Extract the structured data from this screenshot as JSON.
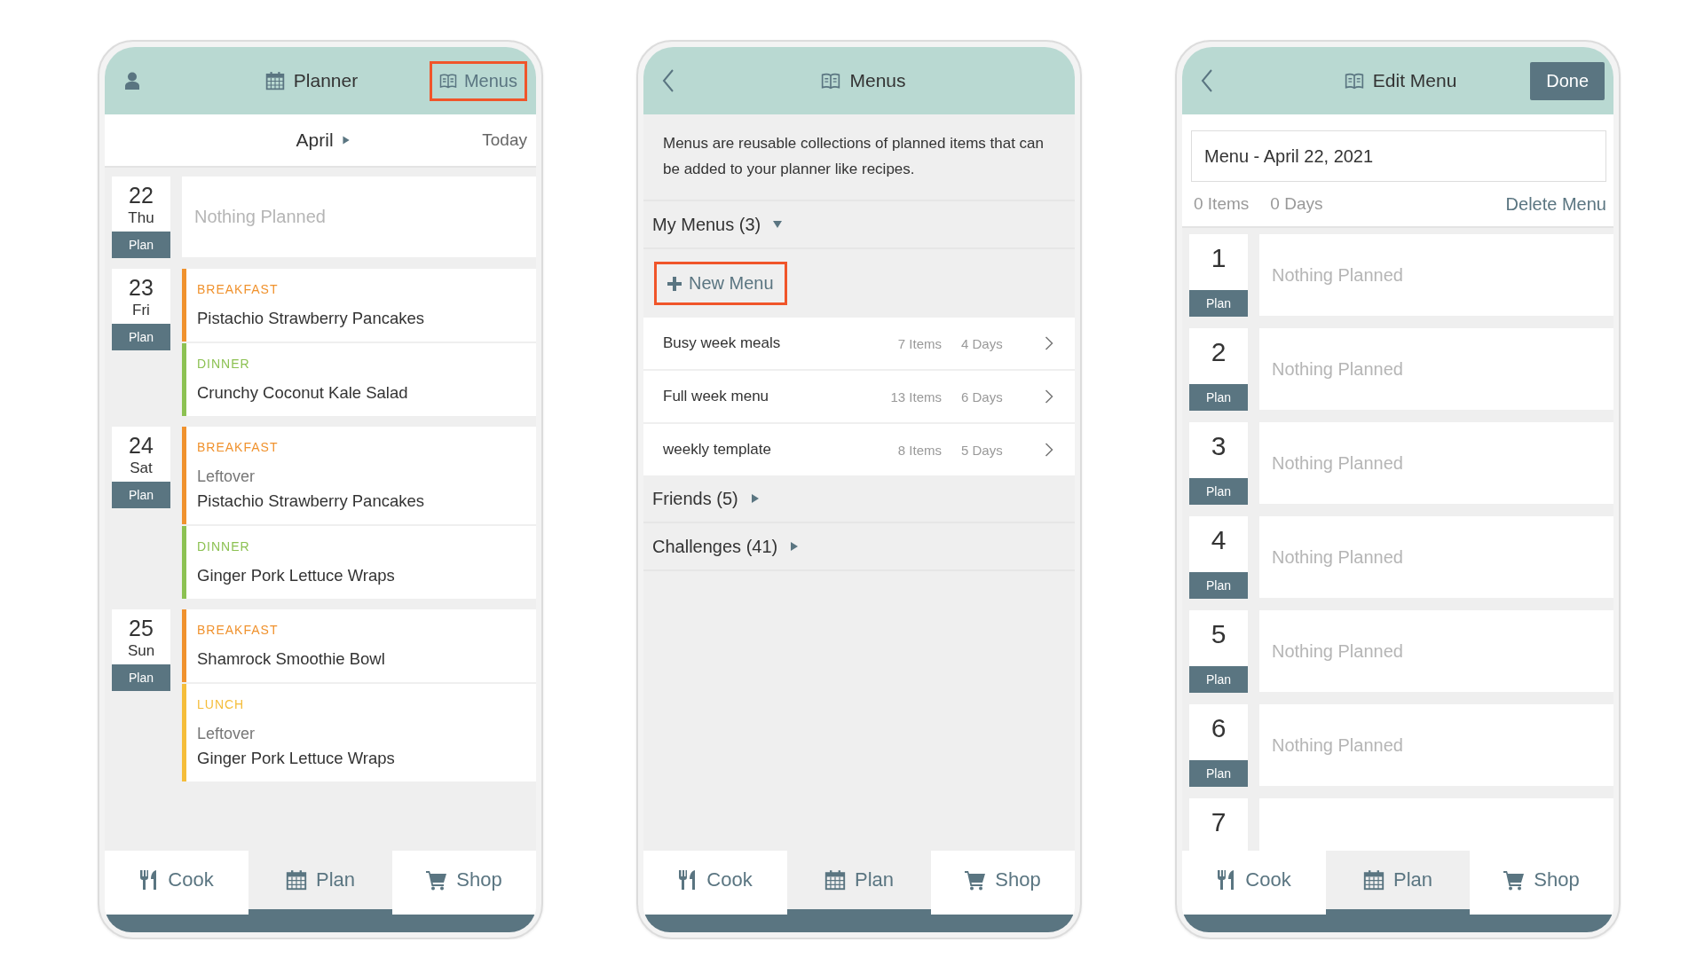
{
  "planner_screen": {
    "header": {
      "title": "Planner",
      "menus_button": {
        "label": "Menus",
        "highlighted": true
      }
    },
    "date_bar": {
      "month": "April",
      "today": "Today"
    },
    "days": [
      {
        "day": "22",
        "weekday": "Thu",
        "plan_button": "Plan",
        "empty_text": "Nothing Planned"
      },
      {
        "day": "23",
        "weekday": "Fri",
        "plan_button": "Plan",
        "meals": [
          {
            "label": "BREAKFAST",
            "color": "#f0922e",
            "recipe": "Pistachio Strawberry Pancakes"
          },
          {
            "label": "DINNER",
            "color": "#8cc152",
            "recipe": "Crunchy Coconut Kale Salad"
          }
        ]
      },
      {
        "day": "24",
        "weekday": "Sat",
        "plan_button": "Plan",
        "meals": [
          {
            "label": "BREAKFAST",
            "color": "#f0922e",
            "note": "Leftover",
            "recipe": "Pistachio Strawberry Pancakes"
          },
          {
            "label": "DINNER",
            "color": "#8cc152",
            "recipe": "Ginger Pork Lettuce Wraps"
          }
        ]
      },
      {
        "day": "25",
        "weekday": "Sun",
        "plan_button": "Plan",
        "meals": [
          {
            "label": "BREAKFAST",
            "color": "#f0922e",
            "recipe": "Shamrock Smoothie Bowl"
          },
          {
            "label": "LUNCH",
            "color": "#f5bd3a",
            "note": "Leftover",
            "recipe": "Ginger Pork Lettuce Wraps"
          }
        ]
      }
    ],
    "tab_bar": [
      {
        "label": "Cook",
        "selected": false
      },
      {
        "label": "Plan",
        "selected": true
      },
      {
        "label": "Shop",
        "selected": false
      }
    ]
  },
  "menus_screen": {
    "header": {
      "title": "Menus"
    },
    "intro": "Menus are reusable collections of planned items that can be added to your planner like recipes.",
    "my_menus": {
      "label": "My Menus (3)",
      "expanded": true,
      "new_menu_button": {
        "label": "New Menu",
        "highlighted": true
      },
      "menus": [
        {
          "name": "Busy week meals",
          "items": "7 Items",
          "days": "4 Days"
        },
        {
          "name": "Full week menu",
          "items": "13 Items",
          "days": "6 Days"
        },
        {
          "name": "weekly template",
          "items": "8 Items",
          "days": "5 Days"
        }
      ]
    },
    "other_sections": [
      {
        "label": "Friends (5)",
        "expanded": false
      },
      {
        "label": "Challenges (41)",
        "expanded": false
      }
    ],
    "tab_bar": [
      {
        "label": "Cook",
        "selected": false
      },
      {
        "label": "Plan",
        "selected": true
      },
      {
        "label": "Shop",
        "selected": false
      }
    ]
  },
  "edit_menu_screen": {
    "header": {
      "title": "Edit Menu",
      "done_button": "Done"
    },
    "name_field": {
      "value": "Menu - April 22, 2021"
    },
    "items_count": "0 Items",
    "days_count": "0 Days",
    "delete_link": "Delete Menu",
    "days": [
      {
        "day": "1",
        "plan_button": "Plan",
        "empty_text": "Nothing Planned"
      },
      {
        "day": "2",
        "plan_button": "Plan",
        "empty_text": "Nothing Planned"
      },
      {
        "day": "3",
        "plan_button": "Plan",
        "empty_text": "Nothing Planned"
      },
      {
        "day": "4",
        "plan_button": "Plan",
        "empty_text": "Nothing Planned"
      },
      {
        "day": "5",
        "plan_button": "Plan",
        "empty_text": "Nothing Planned"
      },
      {
        "day": "6",
        "plan_button": "Plan",
        "empty_text": "Nothing Planned"
      },
      {
        "day": "7"
      }
    ],
    "tab_bar": [
      {
        "label": "Cook",
        "selected": false
      },
      {
        "label": "Plan",
        "selected": true
      },
      {
        "label": "Shop",
        "selected": false
      }
    ]
  }
}
